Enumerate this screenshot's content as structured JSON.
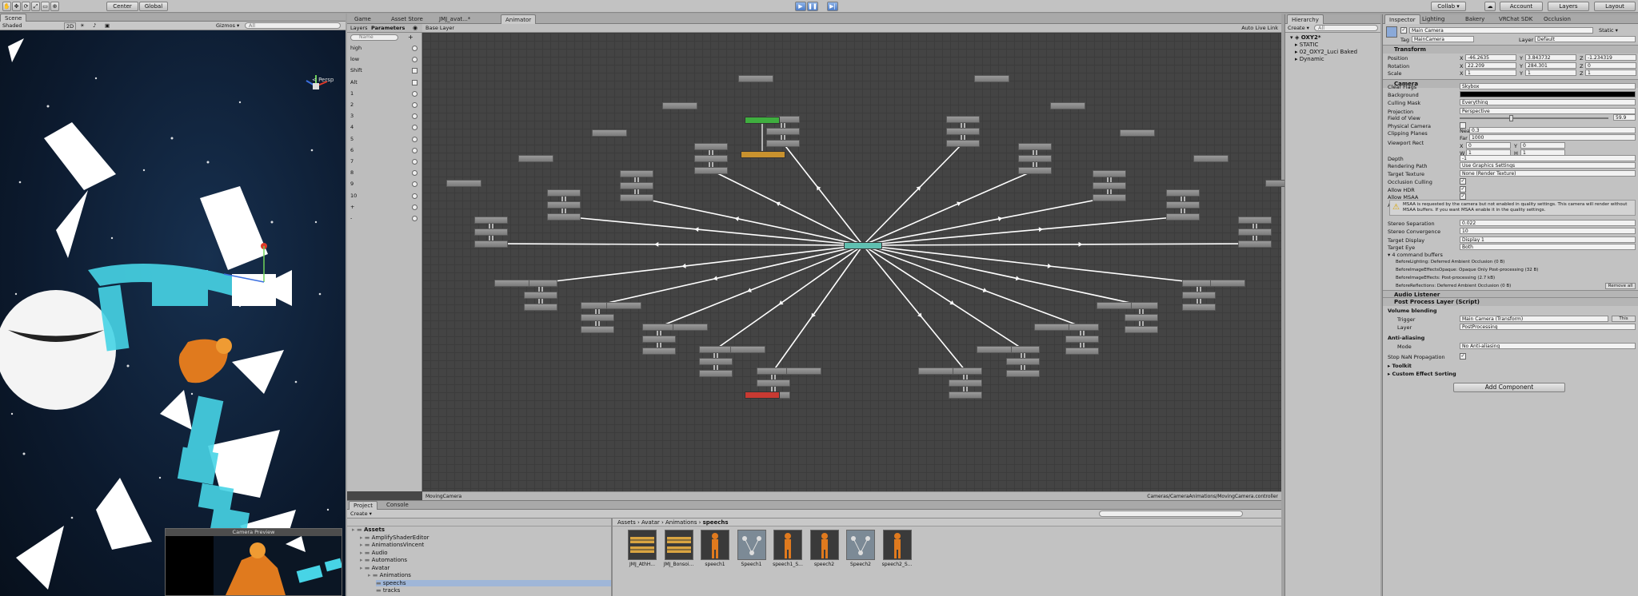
{
  "toolbar": {
    "pivot": "Center",
    "space": "Global",
    "collab": "Collab ▾",
    "account": "Account",
    "layers": "Layers",
    "layout": "Layout"
  },
  "scene": {
    "tab": "Scene",
    "shading": "Shaded",
    "mode2d": "2D",
    "gizmos": "Gizmos ▾",
    "search_placeholder": "All",
    "persp": "< Persp",
    "camera_preview": "Camera Preview"
  },
  "center_tabs": [
    "Game",
    "Asset Store",
    "JMJ_avat...*",
    "Animator"
  ],
  "animator": {
    "layers_tab": "Layers",
    "parameters_tab": "Parameters",
    "search_placeholder": "Name",
    "base_layer": "Base Layer",
    "auto_live_link": "Auto Live Link",
    "footer_left": "MovingCamera",
    "footer_right": "Cameras/CameraAnimations/MovingCamera.controller",
    "parameters": [
      {
        "name": "high",
        "type": "radio"
      },
      {
        "name": "low",
        "type": "radio"
      },
      {
        "name": "Shift",
        "type": "check"
      },
      {
        "name": "Alt",
        "type": "check"
      },
      {
        "name": "1",
        "type": "radio"
      },
      {
        "name": "2",
        "type": "radio"
      },
      {
        "name": "3",
        "type": "radio"
      },
      {
        "name": "4",
        "type": "radio"
      },
      {
        "name": "5",
        "type": "radio"
      },
      {
        "name": "6",
        "type": "radio"
      },
      {
        "name": "7",
        "type": "radio"
      },
      {
        "name": "8",
        "type": "radio"
      },
      {
        "name": "9",
        "type": "radio"
      },
      {
        "name": "10",
        "type": "radio"
      },
      {
        "name": "+",
        "type": "radio"
      },
      {
        "name": "-",
        "type": "radio"
      }
    ],
    "colors": {
      "entry": "#3fae3f",
      "any_state": "#c9922e",
      "exit": "#c83a32",
      "hub": "#5fbfb0"
    }
  },
  "hierarchy": {
    "tab": "Hierarchy",
    "create": "Create ▾",
    "search_placeholder": "All",
    "scene_name": "OXY2*",
    "items": [
      "STATIC",
      "02_OXY2_Luci Baked",
      "Dynamic"
    ]
  },
  "inspector": {
    "tabs": [
      "Inspector",
      "Lighting",
      "Bakery",
      "VRChat SDK",
      "Occlusion"
    ],
    "object_name": "Main Camera",
    "static_label": "Static ▾",
    "tag_label": "Tag",
    "tag_value": "MainCamera",
    "layer_label": "Layer",
    "layer_value": "Default",
    "transform": {
      "title": "Transform",
      "position_label": "Position",
      "position": [
        "-46.2635",
        "3.843732",
        "-1.234319"
      ],
      "rotation_label": "Rotation",
      "rotation": [
        "22.209",
        "284.301",
        "0"
      ],
      "scale_label": "Scale",
      "scale": [
        "1",
        "1",
        "1"
      ]
    },
    "camera": {
      "title": "Camera",
      "rows": [
        {
          "label": "Clear Flags",
          "value": "Skybox"
        },
        {
          "label": "Background",
          "value": ""
        },
        {
          "label": "Culling Mask",
          "value": "Everything"
        },
        {
          "label": "Projection",
          "value": "Perspective"
        },
        {
          "label": "Field of View",
          "value": "59.9"
        },
        {
          "label": "Physical Camera",
          "value": ""
        },
        {
          "label": "Clipping Planes",
          "value": ""
        },
        {
          "label": "Viewport Rect",
          "value": ""
        },
        {
          "label": "Depth",
          "value": "-1"
        },
        {
          "label": "Rendering Path",
          "value": "Use Graphics Settings"
        },
        {
          "label": "Target Texture",
          "value": "None (Render Texture)"
        },
        {
          "label": "Occlusion Culling",
          "value": ""
        },
        {
          "label": "Allow HDR",
          "value": ""
        },
        {
          "label": "Allow MSAA",
          "value": ""
        },
        {
          "label": "Allow Dynamic Resolution",
          "value": ""
        }
      ],
      "near": "0.3",
      "far": "1000",
      "near_label": "Near",
      "far_label": "Far",
      "vp": {
        "x": "0",
        "y": "0",
        "w": "1",
        "h": "1"
      },
      "warning": "MSAA is requested by the camera but not enabled in quality settings. This camera will render without MSAA buffers. If you want MSAA enable it in the quality settings.",
      "stereo_sep_label": "Stereo Separation",
      "stereo_sep": "0.022",
      "stereo_conv_label": "Stereo Convergence",
      "stereo_conv": "10",
      "target_display_label": "Target Display",
      "target_display": "Display 1",
      "target_eye_label": "Target Eye",
      "target_eye": "Both",
      "cmd_buffers": "4 command buffers",
      "buffers": [
        "BeforeLighting: Deferred Ambient Occlusion (0 B)",
        "BeforeImageEffectsOpaque: Opaque Only Post-processing (32 B)",
        "BeforeImageEffects: Post-processing (2.7 kB)",
        "BeforeReflections: Deferred Ambient Occlusion (0 B)"
      ],
      "remove_all": "Remove all"
    },
    "audio_listener": "Audio Listener",
    "ppl": {
      "title": "Post Process Layer (Script)",
      "volume_blending": "Volume blending",
      "trigger_label": "Trigger",
      "trigger_value": "Main Camera (Transform)",
      "this_btn": "This",
      "layer_label": "Layer",
      "layer_value": "PostProcessing",
      "anti_aliasing": "Anti-aliasing",
      "mode_label": "Mode",
      "mode_value": "No Anti-aliasing",
      "stop_nan": "Stop NaN Propagation",
      "toolkit": "Toolkit",
      "custom_sorting": "Custom Effect Sorting"
    },
    "add_component": "Add Component"
  },
  "project": {
    "tabs": [
      "Project",
      "Console"
    ],
    "create": "Create ▾",
    "breadcrumb": [
      "Assets",
      "Avatar",
      "Animations",
      "speechs"
    ],
    "tree": [
      {
        "label": "Assets",
        "depth": 0,
        "bold": true
      },
      {
        "label": "AmplifyShaderEditor",
        "depth": 1
      },
      {
        "label": "AnimationsVincent",
        "depth": 1
      },
      {
        "label": "Audio",
        "depth": 1
      },
      {
        "label": "Automations",
        "depth": 1
      },
      {
        "label": "Avatar",
        "depth": 1
      },
      {
        "label": "Animations",
        "depth": 2
      },
      {
        "label": "speechs",
        "depth": 3,
        "selected": true
      },
      {
        "label": "tracks",
        "depth": 3
      }
    ],
    "assets": [
      {
        "label": "JMJ_AthH...",
        "kind": "anim"
      },
      {
        "label": "JMJ_Bonsoi...",
        "kind": "anim"
      },
      {
        "label": "speech1",
        "kind": "figure"
      },
      {
        "label": "Speech1",
        "kind": "tree"
      },
      {
        "label": "speech1_S...",
        "kind": "figure"
      },
      {
        "label": "speech2",
        "kind": "figure"
      },
      {
        "label": "Speech2",
        "kind": "tree"
      },
      {
        "label": "speech2_S...",
        "kind": "figure"
      }
    ]
  }
}
